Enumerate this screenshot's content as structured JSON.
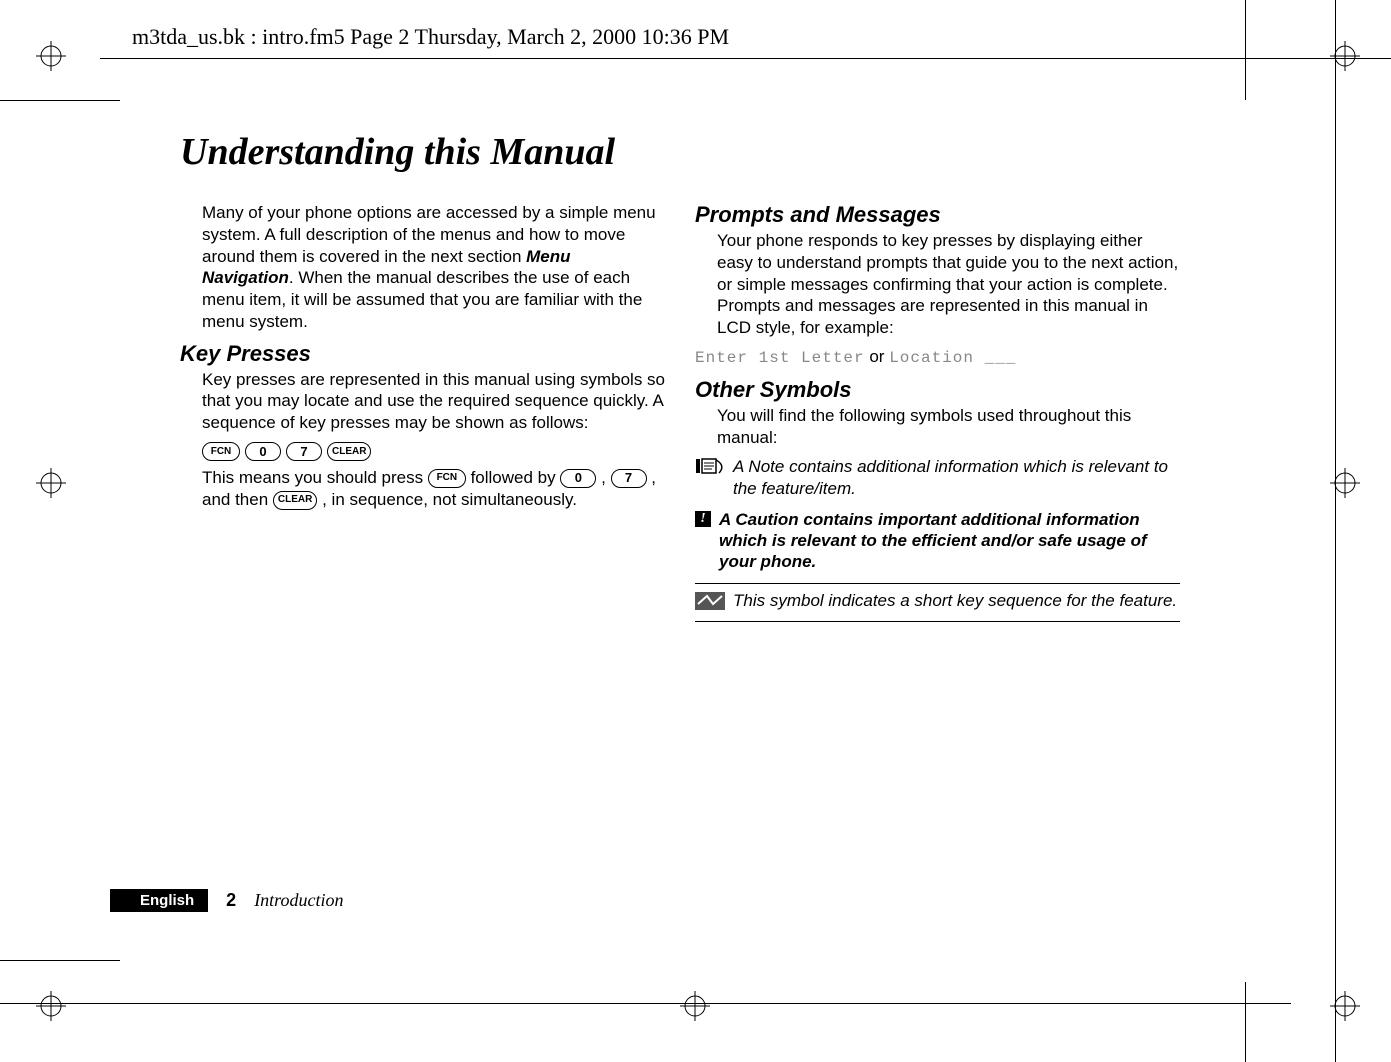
{
  "runhead": "m3tda_us.bk : intro.fm5  Page 2  Thursday, March 2, 2000  10:36 PM",
  "title": "Understanding this Manual",
  "intro_para": "Many of your phone options are accessed by a simple menu system. A full description of the menus and how to move around them is covered in the next section ",
  "intro_ref": "Menu Navigation",
  "intro_tail": ". When the manual describes the use of each menu item, it will be assumed that you are familiar with the menu system.",
  "h_keypresses": "Key Presses",
  "kp_para1": "Key presses are represented in this manual using symbols so that you may locate and use the required sequence quickly. A sequence of key presses may be shown as follows:",
  "keys": {
    "fcn": "FCN",
    "zero": "0",
    "seven": "7",
    "clear": "CLEAR"
  },
  "kp_para2_a": "This means you should press ",
  "kp_para2_b": " followed by ",
  "kp_para2_c": ", ",
  "kp_para2_d": ", and then ",
  "kp_para2_e": ", in sequence, not simultaneously.",
  "h_prompts": "Prompts and Messages",
  "pm_para": "Your phone responds to key presses by displaying either easy to understand prompts that guide you to the next action, or simple messages confirming that your action is complete. Prompts and messages are represented in this manual in LCD style, for example:",
  "lcd1": "Enter 1st Letter",
  "lcd_or": " or ",
  "lcd2": "Location ___",
  "h_other": "Other Symbols",
  "os_intro": "You will find the following symbols used throughout this manual:",
  "note_text": "A Note contains additional information which is relevant to the feature/item.",
  "caution_text": "A Caution contains important additional information which is relevant to the efficient and/or safe usage of your phone.",
  "short_text": "This symbol indicates a short key sequence for the feature.",
  "footer": {
    "language": "English",
    "page": "2",
    "section": "Introduction"
  }
}
